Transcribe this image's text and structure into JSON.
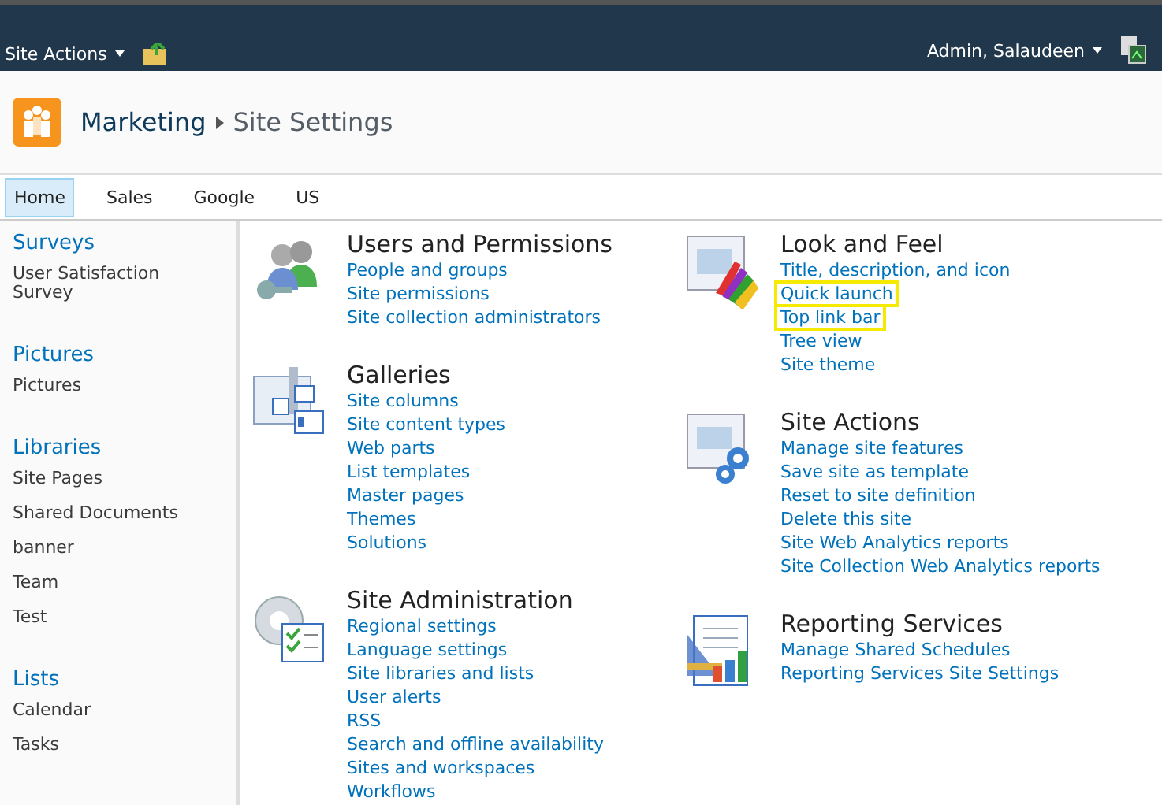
{
  "top_bar": {
    "site_actions": "Site Actions",
    "user": "Admin, Salaudeen"
  },
  "title": {
    "site": "Marketing",
    "page": "Site Settings"
  },
  "tabs": [
    {
      "label": "Home",
      "selected": true
    },
    {
      "label": "Sales",
      "selected": false
    },
    {
      "label": "Google",
      "selected": false
    },
    {
      "label": "US",
      "selected": false
    }
  ],
  "sidebar": [
    {
      "heading": "Surveys",
      "items": [
        "User Satisfaction Survey"
      ]
    },
    {
      "heading": "Pictures",
      "items": [
        "Pictures"
      ]
    },
    {
      "heading": "Libraries",
      "items": [
        "Site Pages",
        "Shared Documents",
        "banner",
        "Team",
        "Test"
      ]
    },
    {
      "heading": "Lists",
      "items": [
        "Calendar",
        "Tasks"
      ]
    }
  ],
  "columns": [
    [
      {
        "title": "Users and Permissions",
        "links": [
          {
            "label": "People and groups",
            "highlighted": false
          },
          {
            "label": "Site permissions",
            "highlighted": false
          },
          {
            "label": "Site collection administrators",
            "highlighted": false
          }
        ]
      },
      {
        "title": "Galleries",
        "links": [
          {
            "label": "Site columns",
            "highlighted": false
          },
          {
            "label": "Site content types",
            "highlighted": false
          },
          {
            "label": "Web parts",
            "highlighted": false
          },
          {
            "label": "List templates",
            "highlighted": false
          },
          {
            "label": "Master pages",
            "highlighted": false
          },
          {
            "label": "Themes",
            "highlighted": false
          },
          {
            "label": "Solutions",
            "highlighted": false
          }
        ]
      },
      {
        "title": "Site Administration",
        "links": [
          {
            "label": "Regional settings",
            "highlighted": false
          },
          {
            "label": "Language settings",
            "highlighted": false
          },
          {
            "label": "Site libraries and lists",
            "highlighted": false
          },
          {
            "label": "User alerts",
            "highlighted": false
          },
          {
            "label": "RSS",
            "highlighted": false
          },
          {
            "label": "Search and offline availability",
            "highlighted": false
          },
          {
            "label": "Sites and workspaces",
            "highlighted": false
          },
          {
            "label": "Workflows",
            "highlighted": false
          }
        ]
      }
    ],
    [
      {
        "title": "Look and Feel",
        "links": [
          {
            "label": "Title, description, and icon",
            "highlighted": false
          },
          {
            "label": "Quick launch",
            "highlighted": true
          },
          {
            "label": "Top link bar",
            "highlighted": true
          },
          {
            "label": "Tree view",
            "highlighted": false
          },
          {
            "label": "Site theme",
            "highlighted": false
          }
        ]
      },
      {
        "title": "Site Actions",
        "links": [
          {
            "label": "Manage site features",
            "highlighted": false
          },
          {
            "label": "Save site as template",
            "highlighted": false
          },
          {
            "label": "Reset to site definition",
            "highlighted": false
          },
          {
            "label": "Delete this site",
            "highlighted": false
          },
          {
            "label": "Site Web Analytics reports",
            "highlighted": false
          },
          {
            "label": "Site Collection Web Analytics reports",
            "highlighted": false
          }
        ]
      },
      {
        "title": "Reporting Services",
        "links": [
          {
            "label": "Manage Shared Schedules",
            "highlighted": false
          },
          {
            "label": "Reporting Services Site Settings",
            "highlighted": false
          }
        ]
      }
    ]
  ]
}
